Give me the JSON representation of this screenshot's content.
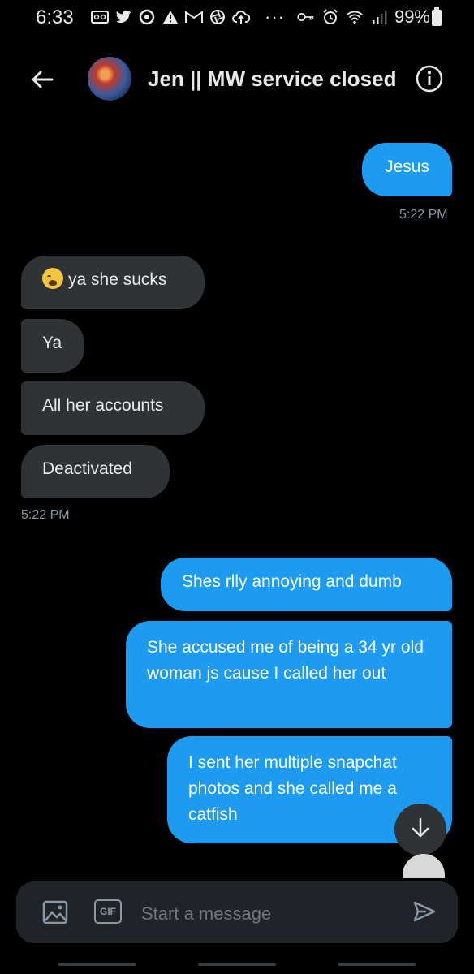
{
  "status_bar": {
    "time": "6:33",
    "battery_pct": "99%",
    "overflow": "···",
    "icons": [
      "voicemail-icon",
      "twitter-icon",
      "sync-icon",
      "alert-icon",
      "gmail-icon",
      "aperture-icon",
      "upload-icon",
      "key-icon",
      "alarm-icon",
      "wifi-icon",
      "signal-icon",
      "battery-icon"
    ]
  },
  "header": {
    "title": "Jen || MW service closed",
    "back_icon": "arrow-left-icon",
    "info_icon": "info-icon"
  },
  "messages": [
    {
      "dir": "out",
      "text": "Jesus"
    },
    {
      "dir": "time",
      "text": "5:22 PM"
    },
    {
      "dir": "in",
      "text": "ya she sucks",
      "emoji": "crying-face-emoji"
    },
    {
      "dir": "in",
      "text": "Ya"
    },
    {
      "dir": "in",
      "text": "All her accounts"
    },
    {
      "dir": "in",
      "text": "Deactivated"
    },
    {
      "dir": "time",
      "text": "5:22 PM"
    },
    {
      "dir": "out",
      "text": "Shes rlly annoying and dumb"
    },
    {
      "dir": "out",
      "text": "She accused me of being a 34 yr old woman js cause I called her out"
    },
    {
      "dir": "out",
      "text": "I sent her multiple snapchat photos and she called me a catfish"
    }
  ],
  "composer": {
    "placeholder": "Start a message",
    "gif_label": "GIF",
    "icons": [
      "image-icon",
      "gif-icon",
      "send-icon"
    ]
  },
  "colors": {
    "background": "#000000",
    "outgoing_bubble": "#1d9bf0",
    "incoming_bubble": "#2f3336",
    "timestamp": "#8b98a5"
  }
}
